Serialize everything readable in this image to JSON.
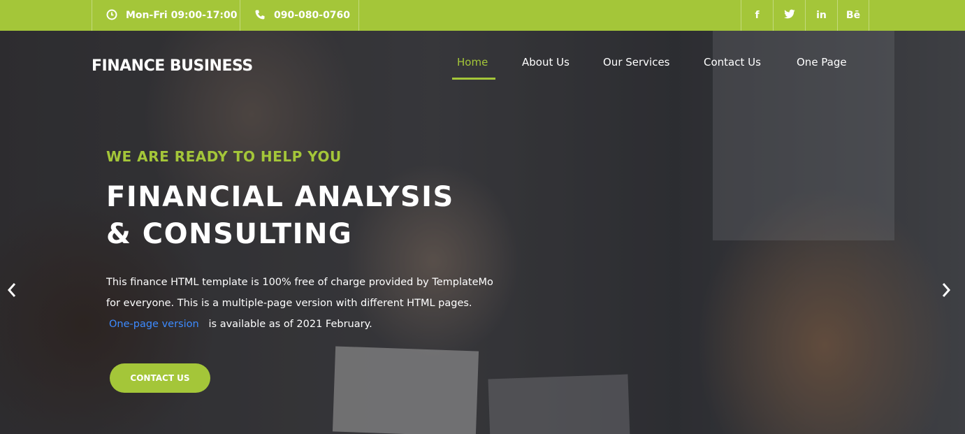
{
  "topbar": {
    "hours": "Mon-Fri 09:00-17:00",
    "phone": "090-080-0760",
    "social": [
      {
        "label": "f",
        "icon": "facebook-icon"
      },
      {
        "label": "t",
        "icon": "twitter-icon"
      },
      {
        "label": "in",
        "icon": "linkedin-icon"
      },
      {
        "label": "Bē",
        "icon": "behance-icon"
      }
    ],
    "bar_color": "#a4c639"
  },
  "header": {
    "logo": "FINANCE BUSINESS",
    "nav": [
      "Home",
      "About Us",
      "Our Services",
      "Contact Us",
      "One Page"
    ],
    "active_nav": "Home"
  },
  "hero": {
    "eyebrow": "WE ARE READY TO HELP YOU",
    "headline_line1": "FINANCIAL ANALYSIS",
    "headline_line2": "& CONSULTING",
    "body_line1": "This finance HTML template is 100% free of charge provided by TemplateMo",
    "body_line2": "for everyone. This is a multiple-page version with different HTML pages.",
    "link_text": "One-page version",
    "body_line3": "is available as of 2021 February.",
    "cta_label": "CONTACT US",
    "accent_color": "#a4c639",
    "link_color": "#3d8bff"
  },
  "carousel": {
    "prev_icon": "chevron-left-icon",
    "next_icon": "chevron-right-icon"
  }
}
